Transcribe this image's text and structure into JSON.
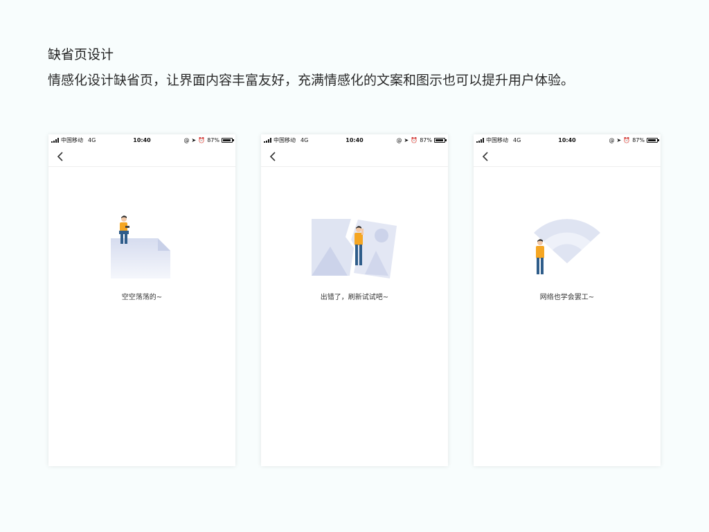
{
  "header": {
    "title": "缺省页设计",
    "description": "情感化设计缺省页，让界面内容丰富友好，充满情感化的文案和图示也可以提升用户体验。"
  },
  "status_bar": {
    "carrier": "中国移动",
    "network": "4G",
    "time": "10:40",
    "battery": "87%",
    "icons": [
      "signal-icon",
      "at-icon",
      "location-arrow-icon",
      "alarm-icon",
      "battery-icon"
    ]
  },
  "navbar": {
    "back_icon": "chevron-left-icon"
  },
  "screens": [
    {
      "caption": "空空荡荡的~",
      "illustration": "empty-document-illustration"
    },
    {
      "caption": "出错了，刷新试试吧~",
      "illustration": "broken-image-illustration"
    },
    {
      "caption": "网络也学会罢工~",
      "illustration": "wifi-illustration"
    }
  ],
  "colors": {
    "background": "#f8fdfd",
    "card": "#ffffff",
    "illustration_blue": "#dfe4f2",
    "illustration_blue_dark": "#ccd3ea",
    "person_shirt": "#f5a623",
    "person_pants": "#2f5d8a",
    "person_hair": "#2b2b2b"
  }
}
